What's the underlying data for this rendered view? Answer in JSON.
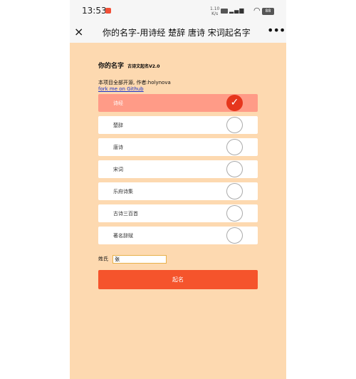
{
  "status_bar": {
    "time": "13:53",
    "net_speed": "1.10\nK/s",
    "battery": "88"
  },
  "nav": {
    "title": "你的名字-用诗经 楚辞 唐诗 宋词起名字",
    "close_icon": "×",
    "more_icon": "•••"
  },
  "header": {
    "title": "你的名字",
    "subtitle": "古诗文起名V2.0",
    "description": "本项目全部开源, 作者:holynova",
    "link": "fork me on Github"
  },
  "options": [
    {
      "label": "诗经",
      "selected": true
    },
    {
      "label": "楚辞",
      "selected": false
    },
    {
      "label": "唐诗",
      "selected": false
    },
    {
      "label": "宋词",
      "selected": false
    },
    {
      "label": "乐府诗集",
      "selected": false
    },
    {
      "label": "古诗三百首",
      "selected": false
    },
    {
      "label": "著名辞赋",
      "selected": false
    }
  ],
  "surname": {
    "label": "姓氏",
    "value": "张"
  },
  "submit_label": "起名",
  "colors": {
    "page_bg": "#fdd9b0",
    "selected_row": "#ff9b87",
    "accent": "#e6361d",
    "button": "#f5542c",
    "link": "#1a31c9"
  }
}
